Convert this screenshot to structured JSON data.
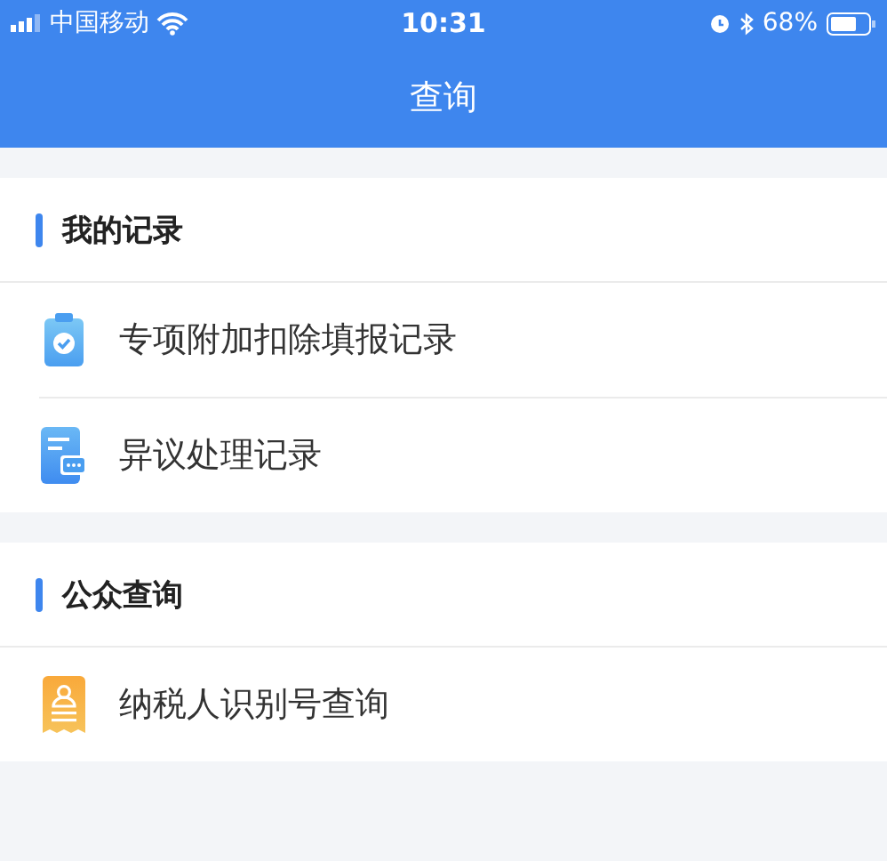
{
  "status_bar": {
    "carrier": "中国移动",
    "time": "10:31",
    "battery": "68%"
  },
  "nav": {
    "title": "查询"
  },
  "sections": [
    {
      "title": "我的记录",
      "items": [
        {
          "label": "专项附加扣除填报记录",
          "kind": "clipboard"
        },
        {
          "label": "异议处理记录",
          "kind": "message"
        }
      ]
    },
    {
      "title": "公众查询",
      "items": [
        {
          "label": "纳税人识别号查询",
          "kind": "receipt"
        }
      ]
    }
  ]
}
